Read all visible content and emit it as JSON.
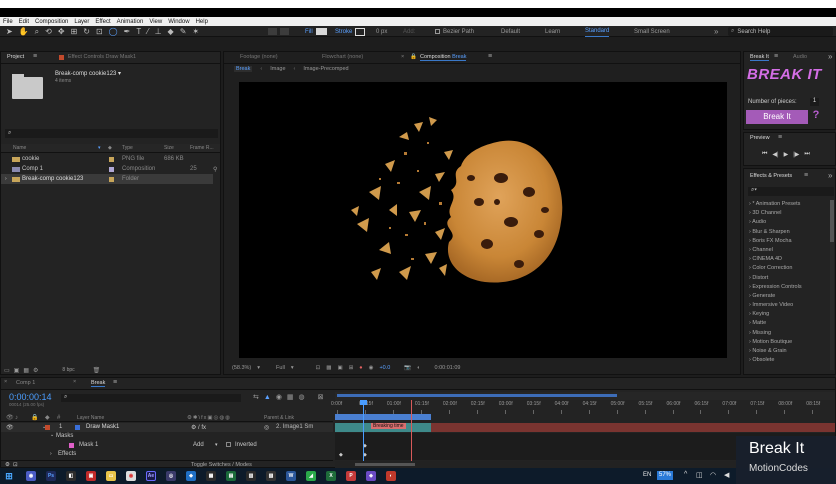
{
  "menu": [
    "File",
    "Edit",
    "Composition",
    "Layer",
    "Effect",
    "Animation",
    "View",
    "Window",
    "Help"
  ],
  "toolbar": {
    "fill": "Fill",
    "stroke": "Stroke",
    "stroke_px": "0 px",
    "add": "Add:",
    "bezier": "Bezier Path",
    "workspaces": [
      "Default",
      "Learn",
      "Standard",
      "Small Screen"
    ],
    "search": "Search Help"
  },
  "project": {
    "tab": "Project",
    "tab2": "Effect Controls Draw Mask1",
    "item_title": "Break-comp cookie123 ▾",
    "item_sub": "4 items",
    "search_icon": "⌕",
    "cols": [
      "Name",
      "Type",
      "Size",
      "Frame R..."
    ],
    "rows": [
      {
        "name": "cookie",
        "type": "PNG file",
        "size": "686 KB",
        "fr": "",
        "color": "#c7a55a"
      },
      {
        "name": "Comp 1",
        "type": "Composition",
        "size": "",
        "fr": "25",
        "color": "#b0a8d6"
      },
      {
        "name": "Break-comp cookie123",
        "type": "Folder",
        "size": "",
        "fr": "",
        "color": "#c7a55a"
      }
    ],
    "bpc": "8 bpc"
  },
  "viewer": {
    "tabs": [
      "Footage (none)",
      "Flowchart (none)"
    ],
    "comp_tab": "Composition",
    "comp_name": "Break",
    "crumbs": [
      "Break",
      "Image",
      "Image-Precomped"
    ],
    "zoom": "(58.3%)",
    "quality": "Full",
    "exposure": "+0.0",
    "timecode": "0:00:01:09"
  },
  "plugin": {
    "tabs": [
      "Break It",
      "Audio"
    ],
    "logo": "BREAK IT",
    "pieces_label": "Number of pieces:",
    "pieces_value": "1",
    "button": "Break It",
    "help": "?"
  },
  "preview": {
    "title": "Preview",
    "controls": [
      "⏮",
      "◀|",
      "▶",
      "|▶",
      "⏭"
    ]
  },
  "effects": {
    "title": "Effects & Presets",
    "search": "⌕▾",
    "items": [
      "* Animation Presets",
      "3D Channel",
      "Audio",
      "Blur & Sharpen",
      "Boris FX Mocha",
      "Channel",
      "CINEMA 4D",
      "Color Correction",
      "Distort",
      "Expression Controls",
      "Generate",
      "Immersive Video",
      "Keying",
      "Matte",
      "Missing",
      "Motion Boutique",
      "Noise & Grain",
      "Obsolete"
    ]
  },
  "timeline": {
    "tabs": [
      "Comp 1",
      "Break"
    ],
    "timecode": "0:00:00:14",
    "fps": "00014 (25.00 fps)",
    "search": "⌕",
    "col_headers": [
      "Layer Name",
      "Parent & Link"
    ],
    "layer": {
      "num": "1",
      "name": "Draw Mask1",
      "parent": "2. Image1 Sm"
    },
    "masks_label": "Masks",
    "mask1": "Mask 1",
    "mask_mode": "Add",
    "inverted": "Inverted",
    "effects_label": "Effects",
    "toggle": "Toggle Switches / Modes",
    "ticks": [
      "0:00f",
      "00:15f",
      "01:00f",
      "01:15f",
      "02:00f",
      "02:15f",
      "03:00f",
      "03:15f",
      "04:00f",
      "04:15f",
      "05:00f",
      "05:15f",
      "06:00f",
      "06:15f",
      "07:00f",
      "07:15f",
      "08:00f",
      "08:15f"
    ],
    "marker": "Breaking time"
  },
  "taskbar": {
    "lang": "EN",
    "battery": "57%"
  },
  "watermark": {
    "title": "Break It",
    "sub": "MotionCodes"
  }
}
